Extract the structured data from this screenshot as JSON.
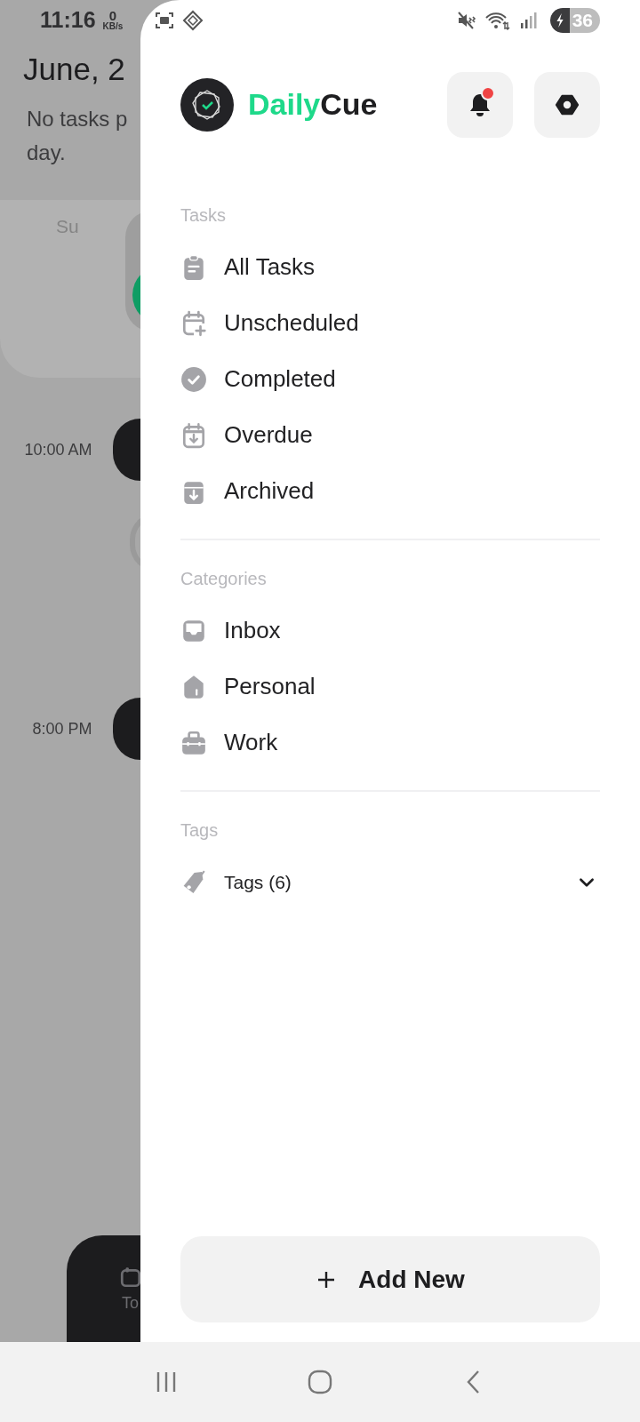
{
  "background": {
    "status_time": "11:16",
    "net_speed_value": "0",
    "net_speed_unit": "KB/s",
    "month_title": "June, 2",
    "subtitle_lines": [
      "No tasks p",
      "day."
    ],
    "weekday": "Su",
    "timeline": [
      {
        "time": "10:00 AM"
      },
      {
        "time": "8:00 PM"
      }
    ],
    "bottom_tab_label": "To"
  },
  "status_bar": {
    "battery": "36"
  },
  "drawer": {
    "brand": {
      "first": "Daily",
      "second": "Cue"
    },
    "notification_unread": true,
    "sections": [
      {
        "title": "Tasks",
        "items": [
          {
            "label": "All Tasks",
            "kind": "clipboard"
          },
          {
            "label": "Unscheduled",
            "kind": "calendar-plus"
          },
          {
            "label": "Completed",
            "kind": "check"
          },
          {
            "label": "Overdue",
            "kind": "calendar-down"
          },
          {
            "label": "Archived",
            "kind": "archive"
          }
        ]
      },
      {
        "title": "Categories",
        "items": [
          {
            "label": "Inbox",
            "kind": "inbox"
          },
          {
            "label": "Personal",
            "kind": "home"
          },
          {
            "label": "Work",
            "kind": "briefcase"
          }
        ]
      }
    ],
    "tags": {
      "title": "Tags",
      "label": "Tags (6)",
      "expanded": false
    },
    "add_button": "Add New"
  }
}
